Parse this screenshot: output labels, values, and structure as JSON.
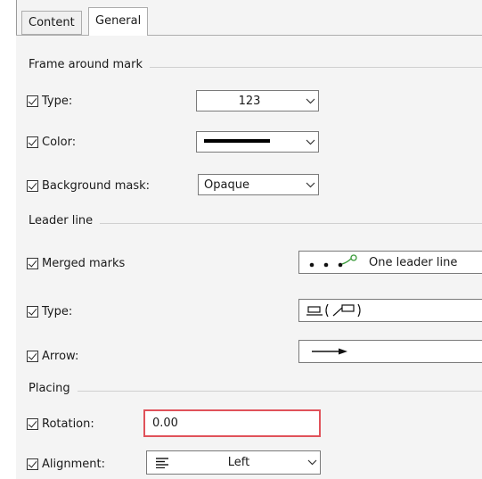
{
  "tabs": [
    {
      "label": "Content",
      "active": false
    },
    {
      "label": "General",
      "active": true
    }
  ],
  "frame_section": {
    "title": "Frame around mark",
    "type": {
      "label": "Type:",
      "checked": true,
      "value": "123"
    },
    "color": {
      "label": "Color:",
      "checked": true,
      "value_icon": "solid-line-swatch"
    },
    "background_mask": {
      "label": "Background mask:",
      "checked": true,
      "value": "Opaque"
    }
  },
  "leader_section": {
    "title": "Leader line",
    "merged_marks": {
      "label": "Merged marks",
      "checked": true,
      "value": "One leader line",
      "value_icon": "merged-dots-icon"
    },
    "type": {
      "label": "Type:",
      "checked": true,
      "value_icon": "leader-type-icon"
    },
    "arrow": {
      "label": "Arrow:",
      "checked": true,
      "value_icon": "arrow-icon"
    }
  },
  "placing_section": {
    "title": "Placing",
    "rotation": {
      "label": "Rotation:",
      "checked": true,
      "value": "0.00"
    },
    "alignment": {
      "label": "Alignment:",
      "checked": true,
      "value": "Left",
      "value_icon": "align-left-icon"
    }
  },
  "colors": {
    "highlight_border": "#e0525a",
    "accent_green": "#3a9a3a"
  }
}
